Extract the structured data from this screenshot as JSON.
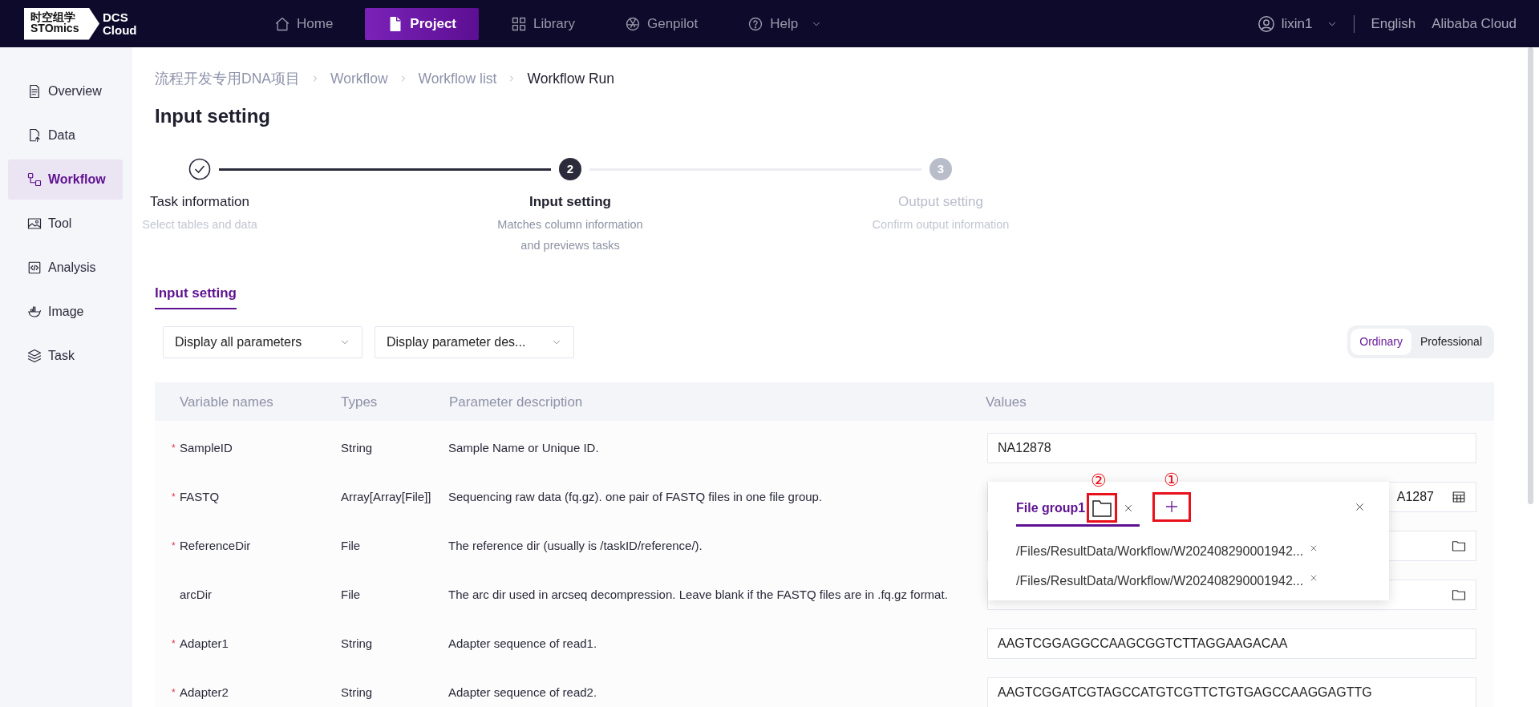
{
  "nav": {
    "logo": {
      "cn": "时空组学",
      "en": "STOmics",
      "product": [
        "DCS",
        "Cloud"
      ]
    },
    "items": [
      {
        "label": "Home",
        "selected": false,
        "dropdown": false
      },
      {
        "label": "Project",
        "selected": true,
        "dropdown": false
      },
      {
        "label": "Library",
        "selected": false,
        "dropdown": false
      },
      {
        "label": "Genpilot",
        "selected": false,
        "dropdown": false
      },
      {
        "label": "Help",
        "selected": false,
        "dropdown": true
      }
    ],
    "user": "lixin1",
    "language": "English",
    "cloud": "Alibaba Cloud"
  },
  "sidebar": {
    "items": [
      {
        "label": "Overview",
        "selected": false
      },
      {
        "label": "Data",
        "selected": false
      },
      {
        "label": "Workflow",
        "selected": true
      },
      {
        "label": "Tool",
        "selected": false
      },
      {
        "label": "Analysis",
        "selected": false
      },
      {
        "label": "Image",
        "selected": false
      },
      {
        "label": "Task",
        "selected": false
      }
    ]
  },
  "breadcrumb": [
    "流程开发专用DNA项目",
    "Workflow",
    "Workflow list",
    "Workflow Run"
  ],
  "page_title": "Input setting",
  "steps": [
    {
      "title": "Task information",
      "description": "Select tables and data",
      "completed": true,
      "selected": false
    },
    {
      "number": "2",
      "title": "Input setting",
      "description": "Matches column information and previews tasks",
      "completed": false,
      "selected": true
    },
    {
      "number": "3",
      "title": "Output setting",
      "description": "Confirm output information",
      "completed": false,
      "selected": false
    }
  ],
  "tabs": [
    {
      "label": "Input setting",
      "selected": true
    }
  ],
  "filters": [
    {
      "value": "Display all parameters"
    },
    {
      "value": "Display parameter des..."
    }
  ],
  "mode_toggle": [
    {
      "label": "Ordinary",
      "selected": true
    },
    {
      "label": "Professional",
      "selected": false
    }
  ],
  "table": {
    "columns": [
      "Variable names",
      "Types",
      "Parameter description",
      "Values"
    ],
    "rows": [
      {
        "required_mark": "*",
        "name": "SampleID",
        "type": "String",
        "description": "Sample Name or Unique ID.",
        "value": "NA12878",
        "kind": "text"
      },
      {
        "required_mark": "*",
        "name": "FASTQ",
        "type": "Array[Array[File]]",
        "description": "Sequencing raw data (fq.gz). one pair of FASTQ files in one file group.",
        "value": "A1287",
        "kind": "file_group"
      },
      {
        "required_mark": "*",
        "name": "ReferenceDir",
        "type": "File",
        "description": "The reference dir (usually is /taskID/reference/).",
        "kind": "file"
      },
      {
        "name": "arcDir",
        "type": "File",
        "description": "The arc dir used in arcseq decompression. Leave blank if the FASTQ files are in .fq.gz format.",
        "kind": "file"
      },
      {
        "required_mark": "*",
        "name": "Adapter1",
        "type": "String",
        "description": "Adapter sequence of read1.",
        "value": "AAGTCGGAGGCCAAGCGGTCTTAGGAAGACAA",
        "kind": "text"
      },
      {
        "required_mark": "*",
        "name": "Adapter2",
        "type": "String",
        "description": "Adapter sequence of read2.",
        "value": "AAGTCGGATCGTAGCCATGTCGTTCTGTGAGCCAAGGAGTTG",
        "kind": "text"
      }
    ]
  },
  "popover": {
    "tabs": [
      {
        "label": "File group1",
        "selected": true
      }
    ],
    "folder_button": {
      "highlighted": true,
      "annotation": "②"
    },
    "add_button": {
      "highlighted": true,
      "annotation": "①"
    },
    "files": [
      "/Files/ResultData/Workflow/W202408290001942...",
      "/Files/ResultData/Workflow/W202408290001942..."
    ]
  }
}
